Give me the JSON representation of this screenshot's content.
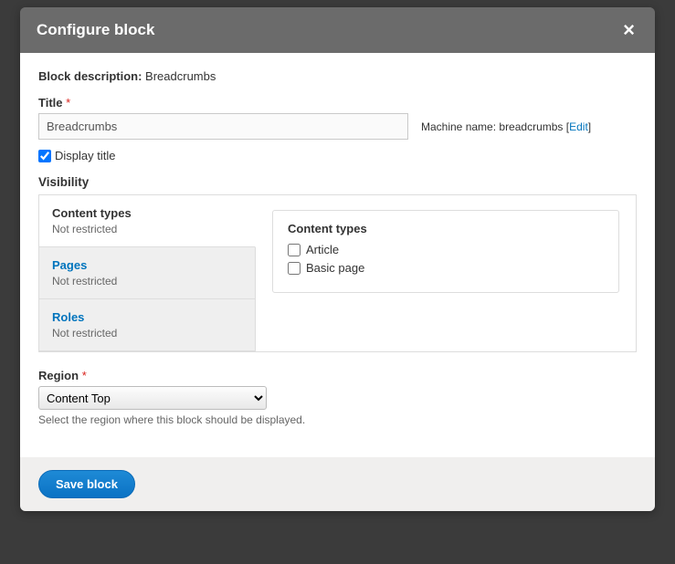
{
  "dialog": {
    "title": "Configure block"
  },
  "block_description": {
    "label": "Block description:",
    "value": "Breadcrumbs"
  },
  "title_field": {
    "label": "Title",
    "value": "Breadcrumbs"
  },
  "machine_name": {
    "label": "Machine name:",
    "value": "breadcrumbs",
    "edit_text": "Edit"
  },
  "display_title": {
    "label": "Display title",
    "checked": true
  },
  "visibility": {
    "label": "Visibility",
    "tabs": [
      {
        "title": "Content types",
        "summary": "Not restricted",
        "active": true
      },
      {
        "title": "Pages",
        "summary": "Not restricted",
        "active": false
      },
      {
        "title": "Roles",
        "summary": "Not restricted",
        "active": false
      }
    ],
    "content_types_pane": {
      "legend": "Content types",
      "options": [
        {
          "label": "Article",
          "checked": false
        },
        {
          "label": "Basic page",
          "checked": false
        }
      ]
    }
  },
  "region": {
    "label": "Region",
    "selected": "Content Top",
    "help": "Select the region where this block should be displayed."
  },
  "actions": {
    "save": "Save block"
  }
}
